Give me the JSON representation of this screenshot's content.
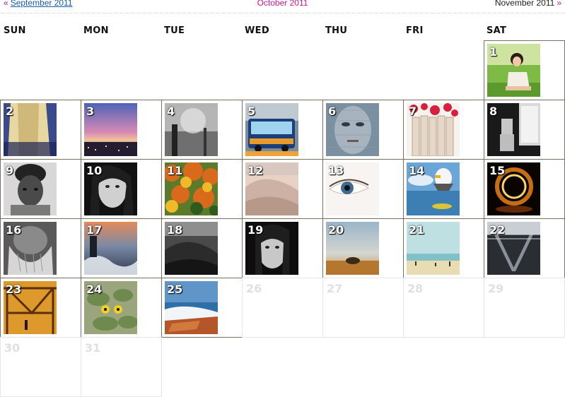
{
  "nav": {
    "prev_arrow": "«",
    "prev_label": "September 2011",
    "current_label": "October 2011",
    "next_label": "November 2011",
    "next_arrow": "»"
  },
  "weekdays": [
    "SUN",
    "MON",
    "TUE",
    "WED",
    "THU",
    "FRI",
    "SAT"
  ],
  "days": [
    {
      "n": "1",
      "photo": "girl-in-grass"
    },
    {
      "n": "2",
      "photo": "blonde-hair"
    },
    {
      "n": "3",
      "photo": "city-dusk"
    },
    {
      "n": "4",
      "photo": "foggy-street"
    },
    {
      "n": "5",
      "photo": "city-bus"
    },
    {
      "n": "6",
      "photo": "face-overlay"
    },
    {
      "n": "7",
      "photo": "fence-flowers"
    },
    {
      "n": "8",
      "photo": "toy-window"
    },
    {
      "n": "9",
      "photo": "man-beanie"
    },
    {
      "n": "10",
      "photo": "woman-portrait"
    },
    {
      "n": "11",
      "photo": "autumn-forest"
    },
    {
      "n": "12",
      "photo": "sand-dunes"
    },
    {
      "n": "13",
      "photo": "eye-closeup"
    },
    {
      "n": "14",
      "photo": "seagull"
    },
    {
      "n": "15",
      "photo": "fire-spin"
    },
    {
      "n": "16",
      "photo": "old-man-beard"
    },
    {
      "n": "17",
      "photo": "rocky-sea"
    },
    {
      "n": "18",
      "photo": "dark-dunes"
    },
    {
      "n": "19",
      "photo": "woman-bw"
    },
    {
      "n": "20",
      "photo": "crab-beach"
    },
    {
      "n": "21",
      "photo": "beach-scene"
    },
    {
      "n": "22",
      "photo": "escalator"
    },
    {
      "n": "23",
      "photo": "bridge-sunset"
    },
    {
      "n": "24",
      "photo": "frog-leaves"
    },
    {
      "n": "25",
      "photo": "coast-waves"
    },
    {
      "n": "26",
      "photo": ""
    },
    {
      "n": "27",
      "photo": ""
    },
    {
      "n": "28",
      "photo": ""
    },
    {
      "n": "29",
      "photo": ""
    },
    {
      "n": "30",
      "photo": ""
    },
    {
      "n": "31",
      "photo": ""
    }
  ]
}
